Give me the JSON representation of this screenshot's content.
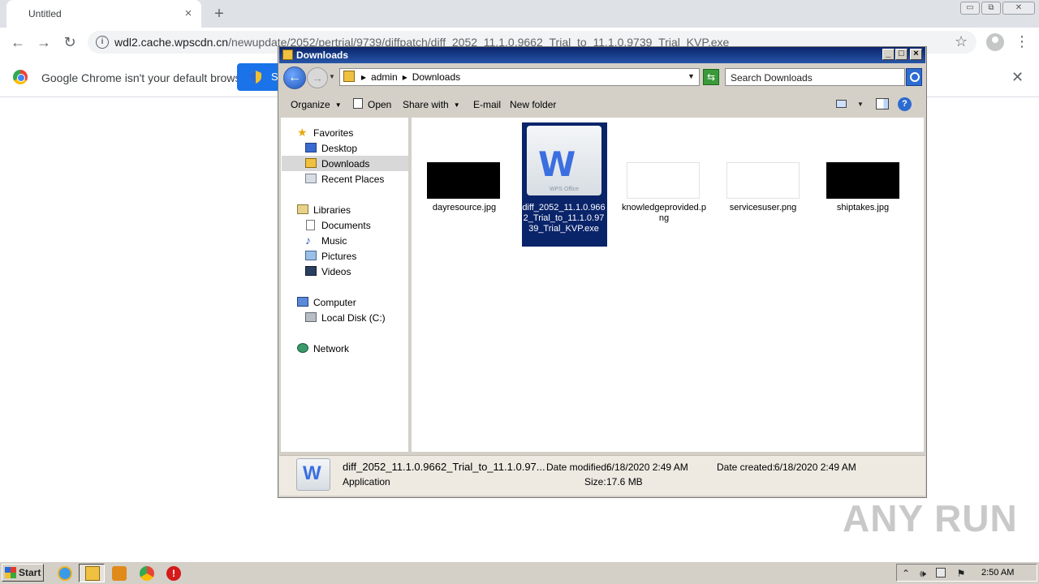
{
  "chrome": {
    "tab_title": "Untitled",
    "tab_close": "×",
    "new_tab": "+",
    "url_host": "wdl2.cache.wpscdn.cn",
    "url_path": "/newupdate/2052/pertrial/9739/diffpatch/diff_2052_11.1.0.9662_Trial_to_11.1.0.9739_Trial_KVP.exe",
    "infobar_text": "Google Chrome isn't your default browser",
    "set_default_label": "Set as default",
    "icons": [
      "back-icon",
      "forward-icon",
      "reload-icon",
      "info-icon",
      "star-icon",
      "profile-icon",
      "menu-icon"
    ]
  },
  "explorer": {
    "title": "Downloads",
    "breadcrumbs": [
      "admin",
      "Downloads"
    ],
    "search_placeholder": "Search Downloads",
    "commands": {
      "organize": "Organize",
      "open": "Open",
      "share_with": "Share with",
      "email": "E-mail",
      "new_folder": "New folder"
    },
    "nav": {
      "favorites": "Favorites",
      "desktop": "Desktop",
      "downloads": "Downloads",
      "recent_places": "Recent Places",
      "libraries": "Libraries",
      "documents": "Documents",
      "music": "Music",
      "pictures": "Pictures",
      "videos": "Videos",
      "computer": "Computer",
      "local_disk": "Local Disk (C:)",
      "network": "Network"
    },
    "files": [
      {
        "name": "dayresource.jpg",
        "thumb_color": "#000000"
      },
      {
        "name": "diff_2052_11.1.0.9662_Trial_to_11.1.0.9739_Trial_KVP.exe",
        "selected": true,
        "icon_text": "WPS Office"
      },
      {
        "name": "knowledgeprovided.png",
        "thumb_color": "#ffffff"
      },
      {
        "name": "servicesuser.png",
        "thumb_color": "#ffffff"
      },
      {
        "name": "shiptakes.jpg",
        "thumb_color": "#000000"
      }
    ],
    "details": {
      "file_name": "diff_2052_11.1.0.9662_Trial_to_11.1.0.97...",
      "file_type": "Application",
      "date_modified_label": "Date modified:",
      "date_modified": "6/18/2020 2:49 AM",
      "size_label": "Size:",
      "size": "17.6 MB",
      "date_created_label": "Date created:",
      "date_created": "6/18/2020 2:49 AM"
    }
  },
  "watermark": "ANY RUN",
  "taskbar": {
    "start_label": "Start",
    "clock": "2:50 AM"
  }
}
